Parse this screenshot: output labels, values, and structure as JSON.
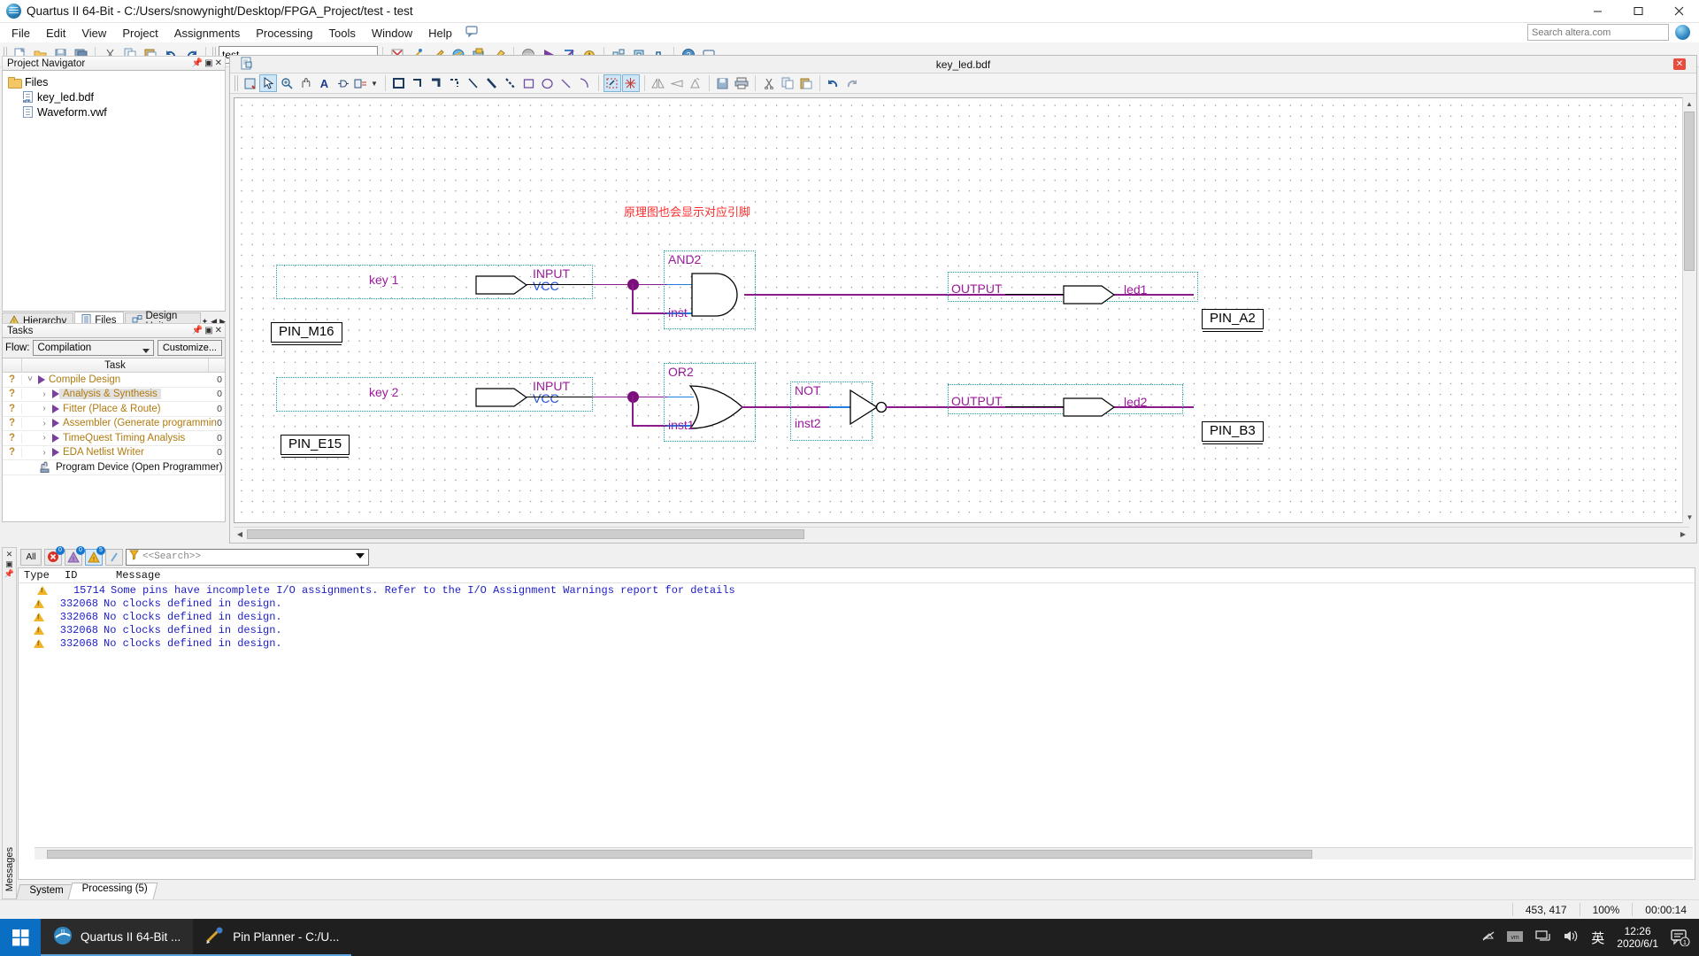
{
  "window": {
    "title": "Quartus II 64-Bit - C:/Users/snowynight/Desktop/FPGA_Project/test - test",
    "minimize": "–",
    "maximize": "▢",
    "close": "✕"
  },
  "menu": {
    "items": [
      "File",
      "Edit",
      "View",
      "Project",
      "Assignments",
      "Processing",
      "Tools",
      "Window",
      "Help"
    ],
    "search_placeholder": "Search altera.com"
  },
  "toolbar": {
    "project_combo_value": "test"
  },
  "project_navigator": {
    "title": "Project Navigator",
    "root": "Files",
    "files": [
      "key_led.bdf",
      "Waveform.vwf"
    ],
    "tabs": [
      {
        "label": "Hierarchy",
        "active": false
      },
      {
        "label": "Files",
        "active": true
      },
      {
        "label": "Design Units",
        "active": false
      }
    ]
  },
  "tasks": {
    "title": "Tasks",
    "flow_label": "Flow:",
    "flow_value": "Compilation",
    "customize_label": "Customize...",
    "column_task": "Task",
    "rows": [
      {
        "status": "?",
        "label": "Compile Design",
        "level": 0,
        "expanded": true,
        "time": "0",
        "selected": false
      },
      {
        "status": "?",
        "label": "Analysis & Synthesis",
        "level": 1,
        "expanded": false,
        "time": "0",
        "selected": true
      },
      {
        "status": "?",
        "label": "Fitter (Place & Route)",
        "level": 1,
        "expanded": false,
        "time": "0",
        "selected": false
      },
      {
        "status": "?",
        "label": "Assembler (Generate programming files)",
        "level": 1,
        "expanded": false,
        "time": "0",
        "selected": false
      },
      {
        "status": "?",
        "label": "TimeQuest Timing Analysis",
        "level": 1,
        "expanded": false,
        "time": "0",
        "selected": false
      },
      {
        "status": "?",
        "label": "EDA Netlist Writer",
        "level": 1,
        "expanded": false,
        "time": "0",
        "selected": false
      },
      {
        "status": "",
        "label": "Program Device (Open Programmer)",
        "level": 1,
        "expanded": null,
        "time": "",
        "selected": false
      }
    ]
  },
  "editor": {
    "tab_title": "key_led.bdf",
    "annotation": "原理图也会显示对应引脚",
    "schematic": {
      "signals": [
        {
          "name": "key 1",
          "pin": "PIN_M16",
          "port_type": "INPUT",
          "port_default": "VCC"
        },
        {
          "name": "key 2",
          "pin": "PIN_E15",
          "port_type": "INPUT",
          "port_default": "VCC"
        },
        {
          "name": "led1",
          "pin": "PIN_A2",
          "port_type": "OUTPUT",
          "port_default": ""
        },
        {
          "name": "led2",
          "pin": "PIN_B3",
          "port_type": "OUTPUT",
          "port_default": ""
        }
      ],
      "gates": [
        {
          "type": "AND2",
          "instance": "inst"
        },
        {
          "type": "OR2",
          "instance": "inst1"
        },
        {
          "type": "NOT",
          "instance": "inst2"
        }
      ]
    }
  },
  "messages": {
    "side_label": "Messages",
    "filters": [
      "All"
    ],
    "error_count": "0",
    "critical_count": "0",
    "warning_count": "5",
    "search_placeholder": "<<Search>>",
    "columns": [
      "Type",
      "ID",
      "Message"
    ],
    "rows": [
      {
        "type": "warning",
        "id": "15714",
        "text": "Some pins have incomplete I/O assignments. Refer to the I/O Assignment Warnings report for details"
      },
      {
        "type": "warning",
        "id": "332068",
        "text": "No clocks defined in design."
      },
      {
        "type": "warning",
        "id": "332068",
        "text": "No clocks defined in design."
      },
      {
        "type": "warning",
        "id": "332068",
        "text": "No clocks defined in design."
      },
      {
        "type": "warning",
        "id": "332068",
        "text": "No clocks defined in design."
      }
    ],
    "tabs": [
      {
        "label": "System",
        "active": false
      },
      {
        "label": "Processing (5)",
        "active": true
      }
    ]
  },
  "statusbar": {
    "coordinates": "453, 417",
    "zoom": "100%",
    "elapsed": "00:00:14"
  },
  "taskbar": {
    "items": [
      "Quartus II 64-Bit ...",
      "Pin Planner - C:/U..."
    ],
    "ime": "英",
    "clock_time": "12:26",
    "clock_date": "2020/6/1",
    "notification_count": "1"
  }
}
